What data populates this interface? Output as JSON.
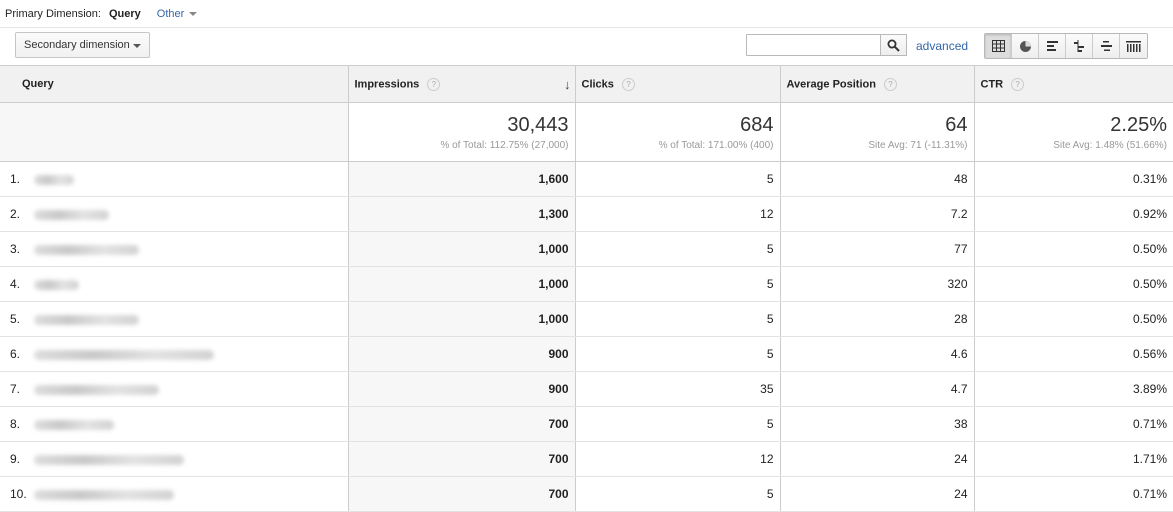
{
  "primary_dimension": {
    "label": "Primary Dimension:",
    "selected": "Query",
    "other": "Other"
  },
  "toolbar": {
    "secondary_dimension": "Secondary dimension",
    "search_value": "",
    "advanced": "advanced"
  },
  "view_icons": [
    "table-view-icon",
    "pie-view-icon",
    "performance-view-icon",
    "comparison-view-icon",
    "term-cloud-view-icon",
    "pivot-view-icon"
  ],
  "columns": {
    "query": "Query",
    "impressions": "Impressions",
    "clicks": "Clicks",
    "average_position": "Average Position",
    "ctr": "CTR",
    "help": "?"
  },
  "totals": {
    "impressions": {
      "value": "30,443",
      "sub": "% of Total: 112.75% (27,000)"
    },
    "clicks": {
      "value": "684",
      "sub": "% of Total: 171.00% (400)"
    },
    "average_position": {
      "value": "64",
      "sub": "Site Avg: 71 (-11.31%)"
    },
    "ctr": {
      "value": "2.25%",
      "sub": "Site Avg: 1.48% (51.66%)"
    }
  },
  "rows": [
    {
      "num": "1.",
      "impressions": "1,600",
      "clicks": "5",
      "position": "48",
      "ctr": "0.31%"
    },
    {
      "num": "2.",
      "impressions": "1,300",
      "clicks": "12",
      "position": "7.2",
      "ctr": "0.92%"
    },
    {
      "num": "3.",
      "impressions": "1,000",
      "clicks": "5",
      "position": "77",
      "ctr": "0.50%"
    },
    {
      "num": "4.",
      "impressions": "1,000",
      "clicks": "5",
      "position": "320",
      "ctr": "0.50%"
    },
    {
      "num": "5.",
      "impressions": "1,000",
      "clicks": "5",
      "position": "28",
      "ctr": "0.50%"
    },
    {
      "num": "6.",
      "impressions": "900",
      "clicks": "5",
      "position": "4.6",
      "ctr": "0.56%"
    },
    {
      "num": "7.",
      "impressions": "900",
      "clicks": "35",
      "position": "4.7",
      "ctr": "3.89%"
    },
    {
      "num": "8.",
      "impressions": "700",
      "clicks": "5",
      "position": "38",
      "ctr": "0.71%"
    },
    {
      "num": "9.",
      "impressions": "700",
      "clicks": "12",
      "position": "24",
      "ctr": "1.71%"
    },
    {
      "num": "10.",
      "impressions": "700",
      "clicks": "5",
      "position": "24",
      "ctr": "0.71%"
    }
  ]
}
